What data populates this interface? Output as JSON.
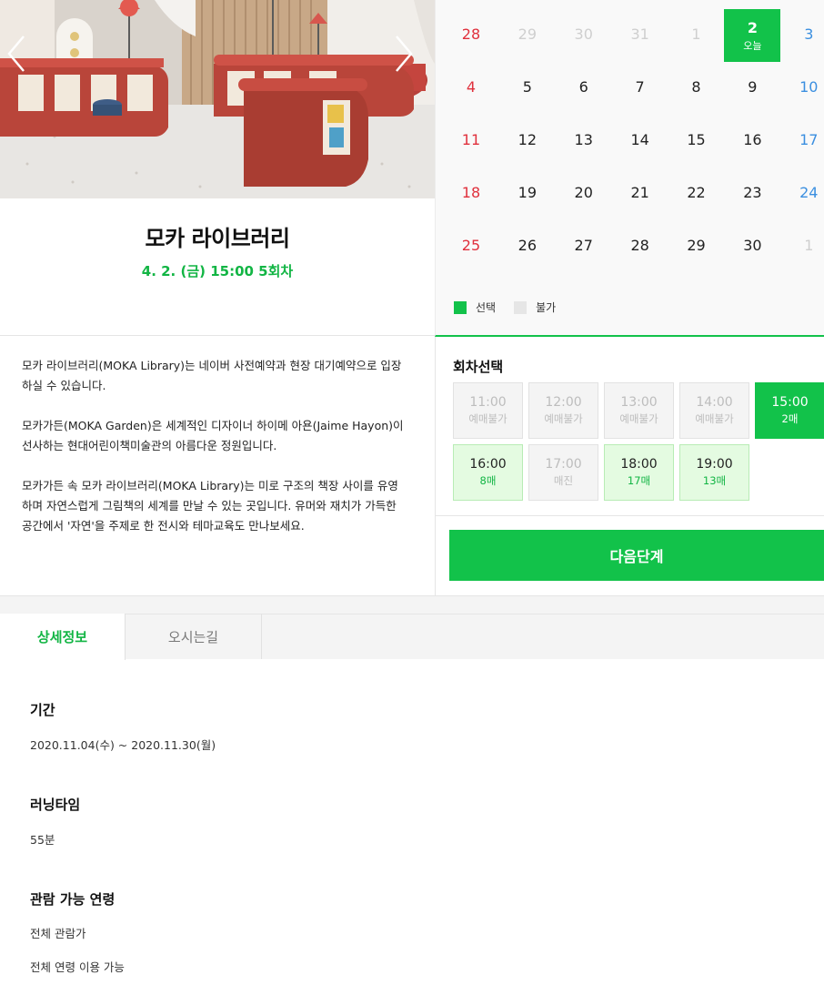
{
  "hero": {
    "prev_icon": "chevron-left-icon",
    "next_icon": "chevron-right-icon"
  },
  "event": {
    "title": "모카 라이브러리",
    "selection": "4. 2. (금) 15:00 5회차"
  },
  "description": [
    "모카 라이브러리(MOKA Library)는 네이버 사전예약과 현장 대기예약으로 입장하실 수 있습니다.",
    "모카가든(MOKA Garden)은 세계적인 디자이너 하이메 아욘(Jaime Hayon)이 선사하는 현대어린이책미술관의 아름다운 정원입니다.",
    "모카가든 속 모카 라이브러리(MOKA Library)는 미로 구조의 책장 사이를 유영하며 자연스럽게 그림책의 세계를 만날 수 있는 곳입니다. 유머와 재치가 가득한 공간에서 '자연'을 주제로 한 전시와 테마교육도 만나보세요."
  ],
  "calendar": {
    "weeks": [
      [
        "28",
        "29",
        "30",
        "31",
        "1",
        "2",
        "3"
      ],
      [
        "4",
        "5",
        "6",
        "7",
        "8",
        "9",
        "10"
      ],
      [
        "11",
        "12",
        "13",
        "14",
        "15",
        "16",
        "17"
      ],
      [
        "18",
        "19",
        "20",
        "21",
        "22",
        "23",
        "24"
      ],
      [
        "25",
        "26",
        "27",
        "28",
        "29",
        "30",
        "1"
      ]
    ],
    "today_label": "오늘",
    "legend": {
      "selected": "선택",
      "unavailable": "불가"
    },
    "colors": {
      "accent": "#12c24a",
      "sunday": "#e0303c",
      "saturday": "#3b8fe0"
    }
  },
  "session": {
    "heading": "회차선택",
    "slots": [
      {
        "time": "11:00",
        "status": "예매불가",
        "state": "off"
      },
      {
        "time": "12:00",
        "status": "예매불가",
        "state": "off"
      },
      {
        "time": "13:00",
        "status": "예매불가",
        "state": "off"
      },
      {
        "time": "14:00",
        "status": "예매불가",
        "state": "off"
      },
      {
        "time": "15:00",
        "status": "2매",
        "state": "sel"
      },
      {
        "time": "16:00",
        "status": "8매",
        "state": "avail"
      },
      {
        "time": "17:00",
        "status": "매진",
        "state": "off"
      },
      {
        "time": "18:00",
        "status": "17매",
        "state": "avail"
      },
      {
        "time": "19:00",
        "status": "13매",
        "state": "avail"
      }
    ],
    "next_button": "다음단계"
  },
  "tabs": {
    "details": "상세정보",
    "directions": "오시는길"
  },
  "info": {
    "period_label": "기간",
    "period_value": "2020.11.04(수) ~ 2020.11.30(월)",
    "runtime_label": "러닝타임",
    "runtime_value": "55분",
    "age_label": "관람 가능 연령",
    "age_value_1": "전체 관람가",
    "age_value_2": "전체 연령 이용 가능"
  }
}
